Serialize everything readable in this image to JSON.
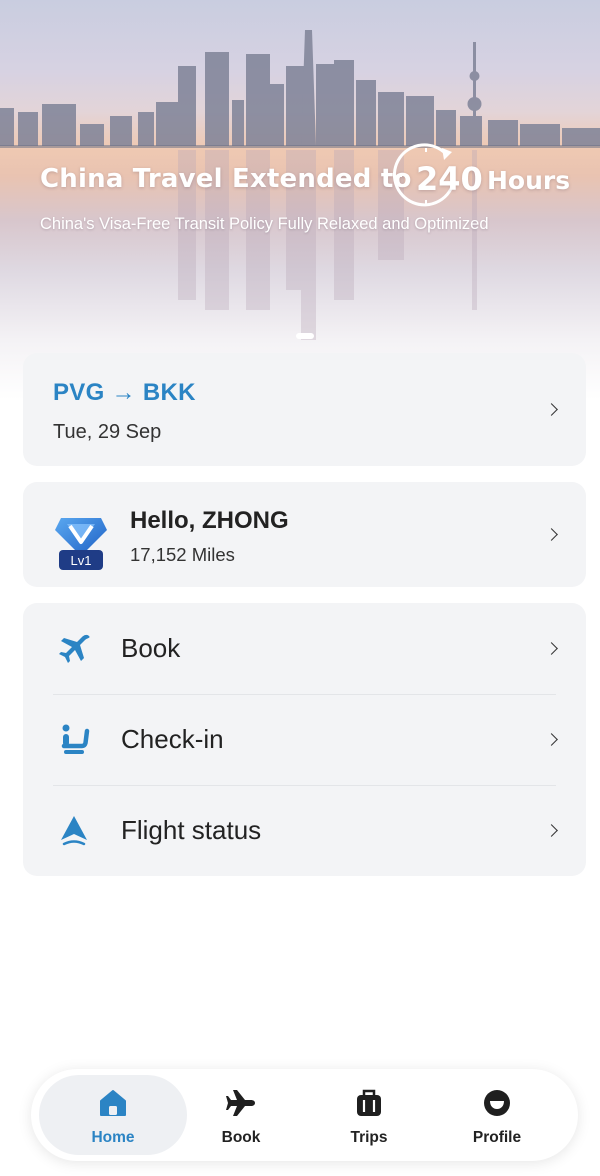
{
  "banner": {
    "title": "China Travel Extended to",
    "hours_number": "240",
    "hours_word": "Hours",
    "subtitle": "China's Visa-Free Transit Policy Fully Relaxed and Optimized",
    "carousel_active_index": 0
  },
  "route": {
    "text": "PVG → BKK",
    "date": "Tue, 29 Sep"
  },
  "member": {
    "greeting": "Hello, ZHONG",
    "miles": "17,152 Miles",
    "level": "Lv1"
  },
  "menu": [
    {
      "label": "Book",
      "icon": "plane-icon"
    },
    {
      "label": "Check-in",
      "icon": "seat-icon"
    },
    {
      "label": "Flight status",
      "icon": "navigation-arrow-icon"
    }
  ],
  "bottom_nav": {
    "active": "Home",
    "items": [
      {
        "label": "Home",
        "icon": "home-icon"
      },
      {
        "label": "Book",
        "icon": "plane-icon"
      },
      {
        "label": "Trips",
        "icon": "suitcase-icon"
      },
      {
        "label": "Profile",
        "icon": "smiley-icon"
      }
    ]
  },
  "colors": {
    "accent": "#2b84c4",
    "card_bg": "#f3f4f6",
    "text": "#222222"
  }
}
